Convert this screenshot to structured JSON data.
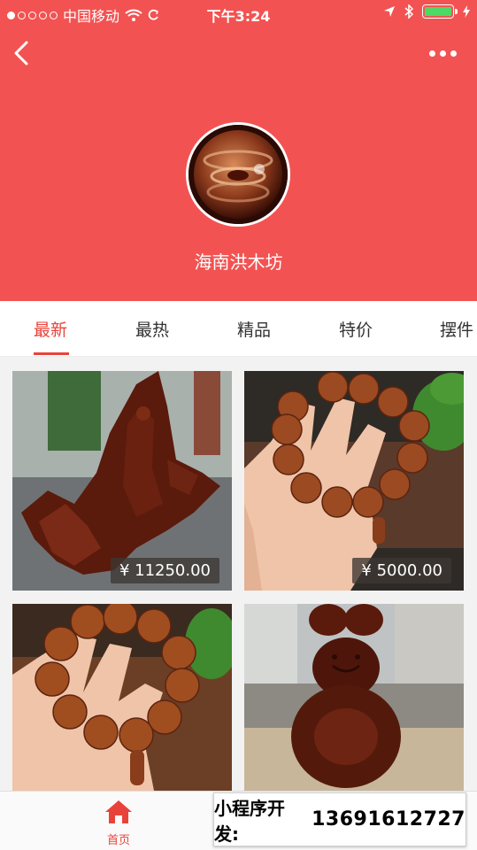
{
  "status_bar": {
    "carrier": "中国移动",
    "time": "下午3:24",
    "signal_dots_filled": 1,
    "signal_dots_total": 5
  },
  "header": {
    "shop_name": "海南洪木坊",
    "background": "#f25352"
  },
  "tabs": [
    {
      "label": "最新",
      "active": true
    },
    {
      "label": "最热",
      "active": false
    },
    {
      "label": "精品",
      "active": false
    },
    {
      "label": "特价",
      "active": false
    },
    {
      "label": "摆件",
      "active": false
    }
  ],
  "products": [
    {
      "price": "¥ 11250.00",
      "image": "guanyin-carving"
    },
    {
      "price": "¥ 5000.00",
      "image": "bead-bracelet-hand"
    },
    {
      "price": "",
      "image": "bead-bracelet-hand-2"
    },
    {
      "price": "",
      "image": "laughing-buddha-carving"
    }
  ],
  "bottom_nav": {
    "home_label": "首页"
  },
  "watermark": {
    "label": "小程序开发:",
    "phone": "13691612727"
  },
  "colors": {
    "accent": "#e8433b",
    "header": "#f25352",
    "battery": "#4cd964"
  }
}
